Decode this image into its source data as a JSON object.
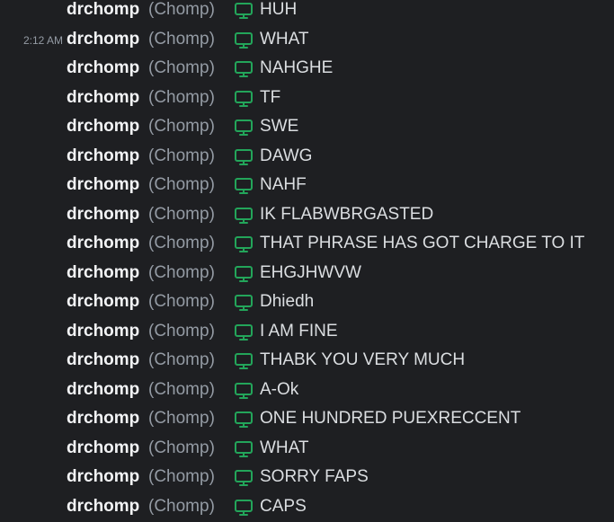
{
  "colors": {
    "background": "#1e1f22",
    "username": "#f2f3f5",
    "nickname": "#949ba4",
    "message": "#dbdee1",
    "device_icon": "#23a55a"
  },
  "device_icon": "monitor-icon",
  "messages": [
    {
      "timestamp": "",
      "author": "drchomp",
      "nickname": "(Chomp)",
      "text": "HUH"
    },
    {
      "timestamp": "2:12 AM",
      "author": "drchomp",
      "nickname": "(Chomp)",
      "text": "WHAT"
    },
    {
      "timestamp": "",
      "author": "drchomp",
      "nickname": "(Chomp)",
      "text": "NAHGHE"
    },
    {
      "timestamp": "",
      "author": "drchomp",
      "nickname": "(Chomp)",
      "text": "TF"
    },
    {
      "timestamp": "",
      "author": "drchomp",
      "nickname": "(Chomp)",
      "text": "SWE"
    },
    {
      "timestamp": "",
      "author": "drchomp",
      "nickname": "(Chomp)",
      "text": "DAWG"
    },
    {
      "timestamp": "",
      "author": "drchomp",
      "nickname": "(Chomp)",
      "text": "NAHF"
    },
    {
      "timestamp": "",
      "author": "drchomp",
      "nickname": "(Chomp)",
      "text": "IK FLABWBRGASTED"
    },
    {
      "timestamp": "",
      "author": "drchomp",
      "nickname": "(Chomp)",
      "text": "THAT PHRASE HAS GOT CHARGE TO IT"
    },
    {
      "timestamp": "",
      "author": "drchomp",
      "nickname": "(Chomp)",
      "text": "EHGJHWVW"
    },
    {
      "timestamp": "",
      "author": "drchomp",
      "nickname": "(Chomp)",
      "text": "Dhiedh"
    },
    {
      "timestamp": "",
      "author": "drchomp",
      "nickname": "(Chomp)",
      "text": "I AM FINE"
    },
    {
      "timestamp": "",
      "author": "drchomp",
      "nickname": "(Chomp)",
      "text": "THABK YOU VERY MUCH"
    },
    {
      "timestamp": "",
      "author": "drchomp",
      "nickname": "(Chomp)",
      "text": "A-Ok"
    },
    {
      "timestamp": "",
      "author": "drchomp",
      "nickname": "(Chomp)",
      "text": "ONE HUNDRED PUEXRECCENT"
    },
    {
      "timestamp": "",
      "author": "drchomp",
      "nickname": "(Chomp)",
      "text": "WHAT"
    },
    {
      "timestamp": "",
      "author": "drchomp",
      "nickname": "(Chomp)",
      "text": "SORRY FAPS"
    },
    {
      "timestamp": "",
      "author": "drchomp",
      "nickname": "(Chomp)",
      "text": "CAPS"
    }
  ]
}
